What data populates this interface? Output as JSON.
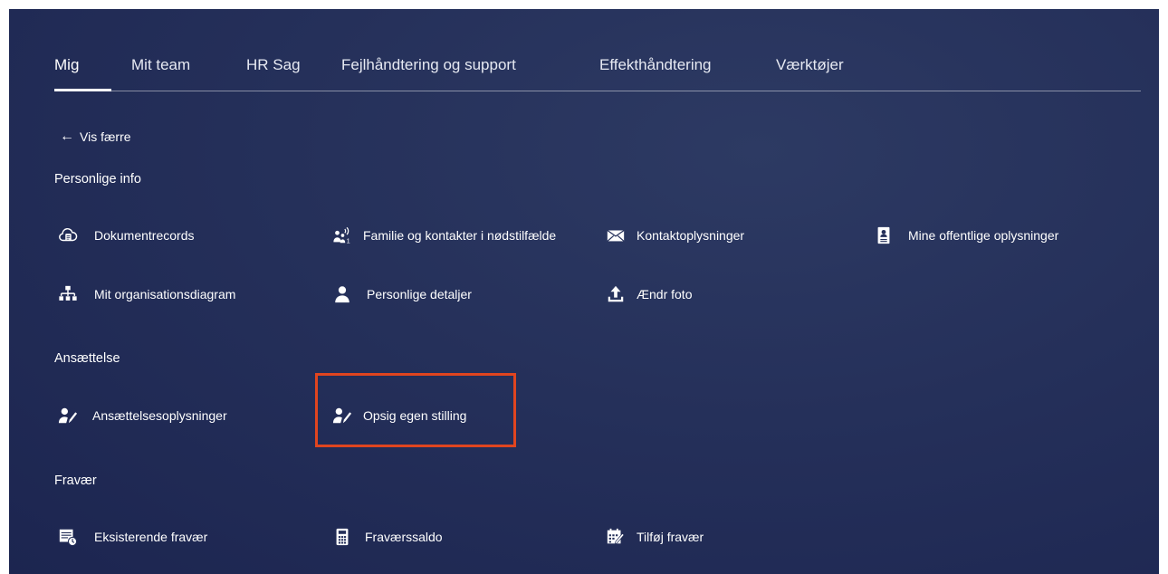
{
  "tabs": [
    {
      "label": "Mig"
    },
    {
      "label": "Mit team"
    },
    {
      "label": "HR Sag"
    },
    {
      "label": "Fejlhåndtering og support"
    },
    {
      "label": "Effekthåndtering"
    },
    {
      "label": "Værktøjer"
    }
  ],
  "back_link": {
    "label": "Vis færre"
  },
  "sections": [
    {
      "title": "Personlige info",
      "items": [
        {
          "label": "Dokumentrecords",
          "icon": "cloud-document-icon"
        },
        {
          "label": "Familie og kontakter i nødstilfælde",
          "icon": "family-contacts-icon"
        },
        {
          "label": "Kontaktoplysninger",
          "icon": "envelope-icon"
        },
        {
          "label": "Mine offentlige oplysninger",
          "icon": "id-badge-icon"
        },
        {
          "label": "Mit organisationsdiagram",
          "icon": "org-chart-icon"
        },
        {
          "label": "Personlige detaljer",
          "icon": "person-icon"
        },
        {
          "label": "Ændr foto",
          "icon": "upload-icon"
        }
      ]
    },
    {
      "title": "Ansættelse",
      "items": [
        {
          "label": "Ansættelsesoplysninger",
          "icon": "person-edit-icon"
        },
        {
          "label": "Opsig egen stilling",
          "icon": "person-edit-icon"
        }
      ]
    },
    {
      "title": "Fravær",
      "items": [
        {
          "label": "Eksisterende fravær",
          "icon": "calendar-clock-icon"
        },
        {
          "label": "Fraværssaldo",
          "icon": "calculator-icon"
        },
        {
          "label": "Tilføj fravær",
          "icon": "calendar-edit-icon"
        }
      ]
    }
  ],
  "colors": {
    "background": "#25305a",
    "highlight_border": "#e0451f",
    "text": "#ffffff"
  }
}
